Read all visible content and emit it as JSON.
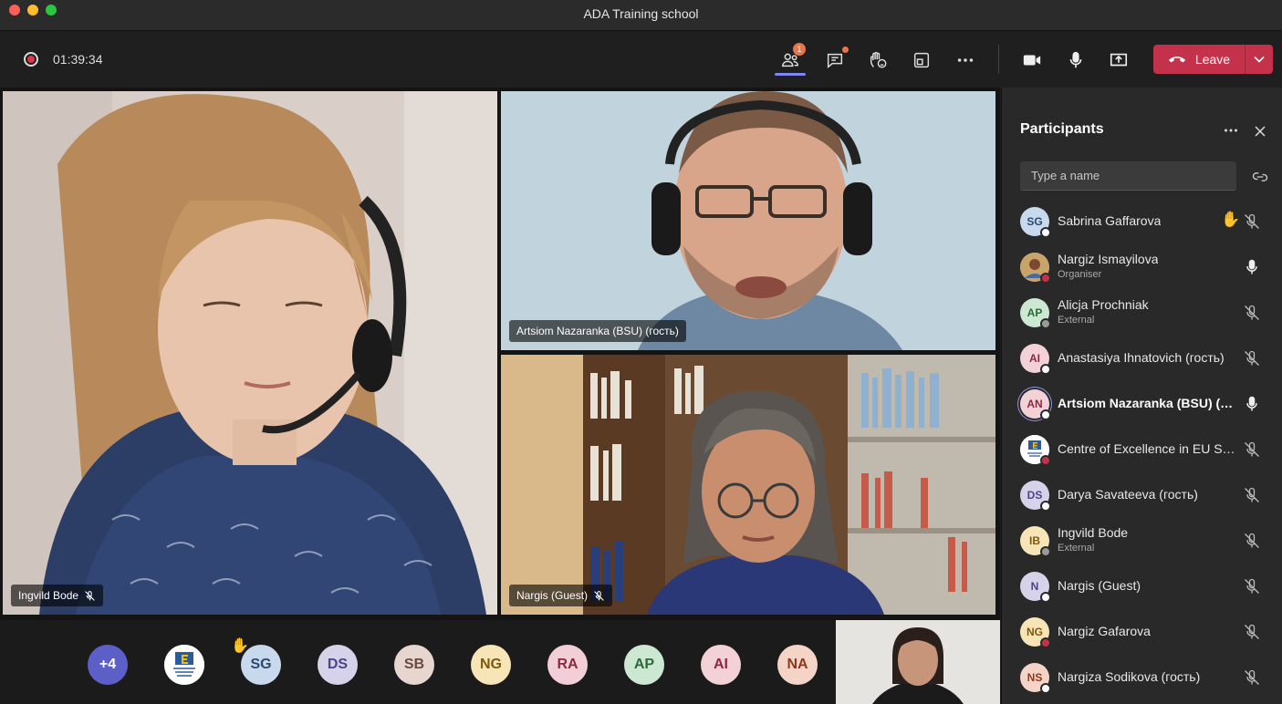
{
  "window": {
    "title": "ADA Training school"
  },
  "toolbar": {
    "timer": "01:39:34",
    "participants_badge": "1",
    "leave_label": "Leave"
  },
  "stage": {
    "tiles": [
      {
        "name": "Ingvild Bode",
        "muted": true
      },
      {
        "name": "Artsiom Nazaranka (BSU) (гость)",
        "muted": false
      },
      {
        "name": "Nargis (Guest)",
        "muted": true
      }
    ]
  },
  "gallery": {
    "items": [
      {
        "initials": "+4",
        "bg": "#5b5fc7",
        "fg": "#ffffff"
      },
      {
        "initials": "",
        "bg": "#ffffff",
        "fg": "#2d5b9a"
      },
      {
        "initials": "SG",
        "bg": "#c8d9ee",
        "fg": "#2c4a6e"
      },
      {
        "initials": "DS",
        "bg": "#d5d2ea",
        "fg": "#4b4585"
      },
      {
        "initials": "SB",
        "bg": "#e6d6cf",
        "fg": "#6b4a3d"
      },
      {
        "initials": "NG",
        "bg": "#f7e5b8",
        "fg": "#7a5a10"
      },
      {
        "initials": "RA",
        "bg": "#f2cfd6",
        "fg": "#8a2a40"
      },
      {
        "initials": "AP",
        "bg": "#cde8d2",
        "fg": "#2b6a3a"
      },
      {
        "initials": "AI",
        "bg": "#f2d2d6",
        "fg": "#8a2a40"
      },
      {
        "initials": "NA",
        "bg": "#f4d4c6",
        "fg": "#8a3a1e"
      }
    ]
  },
  "panel": {
    "title": "Participants",
    "search_placeholder": "Type a name",
    "participants": [
      {
        "initials": "SG",
        "name": "Sabrina Gaffarova",
        "sub": "",
        "bg": "#c8d9ee",
        "fg": "#2c4a6e",
        "status": "white",
        "mic": "muted",
        "hand": true,
        "bold": false
      },
      {
        "initials": "",
        "name": "Nargiz Ismayilova",
        "sub": "Organiser",
        "bg": "#b5925e",
        "fg": "#fff",
        "status": "red",
        "mic": "on",
        "hand": false,
        "bold": false
      },
      {
        "initials": "AP",
        "name": "Alicja Prochniak",
        "sub": "External",
        "bg": "#cde8d2",
        "fg": "#2b6a3a",
        "status": "grey",
        "mic": "muted",
        "hand": false,
        "bold": false
      },
      {
        "initials": "AI",
        "name": "Anastasiya Ihnatovich (гость)",
        "sub": "",
        "bg": "#f2d2d6",
        "fg": "#8a2a40",
        "status": "white",
        "mic": "muted",
        "hand": false,
        "bold": false
      },
      {
        "initials": "AN",
        "name": "Artsiom Nazaranka (BSU) (го...",
        "sub": "",
        "bg": "#f2d2d6",
        "fg": "#8a2a40",
        "status": "white",
        "mic": "on",
        "hand": false,
        "bold": true
      },
      {
        "initials": "",
        "name": "Centre of Excellence in EU Stu...",
        "sub": "",
        "bg": "#ffffff",
        "fg": "#2d5b9a",
        "status": "red",
        "mic": "muted",
        "hand": false,
        "bold": false
      },
      {
        "initials": "DS",
        "name": "Darya Savateeva (гость)",
        "sub": "",
        "bg": "#d5d2ea",
        "fg": "#4b4585",
        "status": "white",
        "mic": "muted",
        "hand": false,
        "bold": false
      },
      {
        "initials": "IB",
        "name": "Ingvild Bode",
        "sub": "External",
        "bg": "#f7e5b8",
        "fg": "#7a5a10",
        "status": "grey",
        "mic": "muted",
        "hand": false,
        "bold": false
      },
      {
        "initials": "N",
        "name": "Nargis (Guest)",
        "sub": "",
        "bg": "#d5d2ea",
        "fg": "#4b4585",
        "status": "white",
        "mic": "muted",
        "hand": false,
        "bold": false
      },
      {
        "initials": "NG",
        "name": "Nargiz Gafarova",
        "sub": "",
        "bg": "#f7e5b8",
        "fg": "#7a5a10",
        "status": "red",
        "mic": "muted",
        "hand": false,
        "bold": false
      },
      {
        "initials": "NS",
        "name": "Nargiza Sodikova (гость)",
        "sub": "",
        "bg": "#f4d4c6",
        "fg": "#8a3a1e",
        "status": "white",
        "mic": "muted",
        "hand": false,
        "bold": false
      }
    ]
  }
}
